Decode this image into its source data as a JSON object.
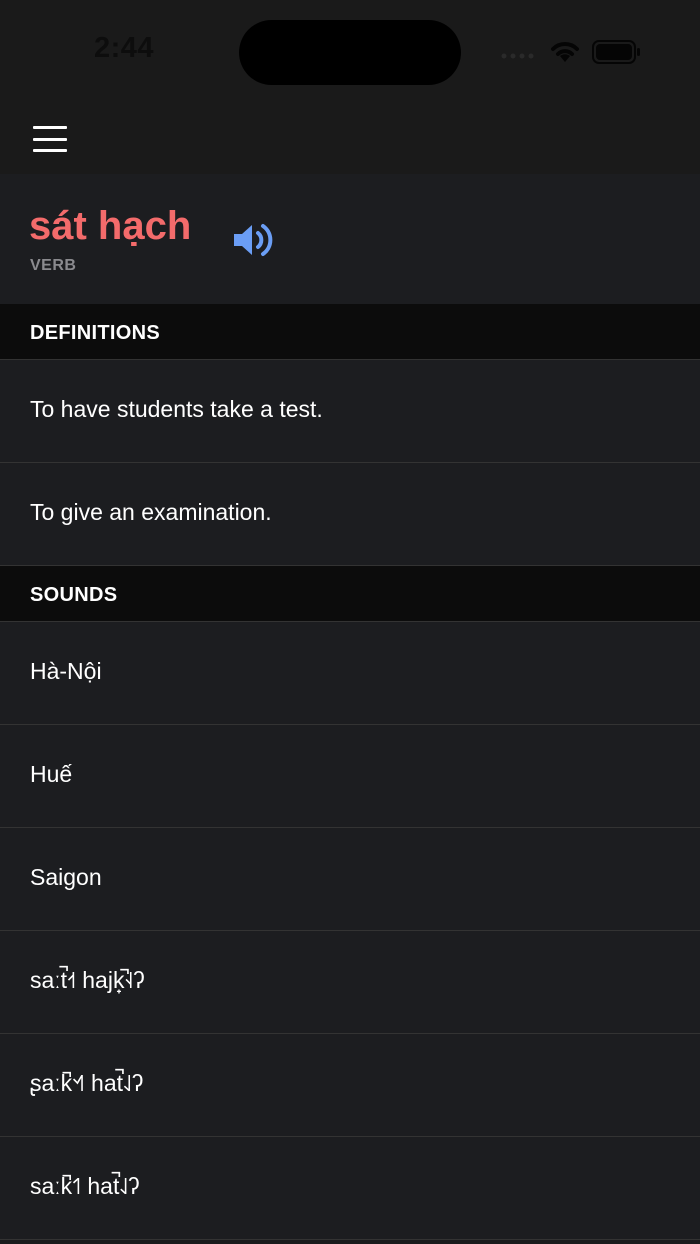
{
  "status_bar": {
    "time": "2:44"
  },
  "word": {
    "title": "sát hạch",
    "part_of_speech": "VERB"
  },
  "definitions": {
    "header": "DEFINITIONS",
    "items": [
      "To have students take a test.",
      "To give an examination."
    ]
  },
  "sounds": {
    "header": "SOUNDS",
    "items": [
      "Hà-Nội",
      "Huế",
      "Saigon",
      "saːt̚˧˦ hajk̟̚˧˨ʔ",
      "ʂaːk̚˦˧˥ hat̚˨˩ʔ",
      "saːk̚˦˥ hat̚˨˩ʔ"
    ]
  },
  "colors": {
    "accent_word": "#f36b6b",
    "speaker_icon": "#6b9ef5",
    "background": "#1c1d20"
  }
}
